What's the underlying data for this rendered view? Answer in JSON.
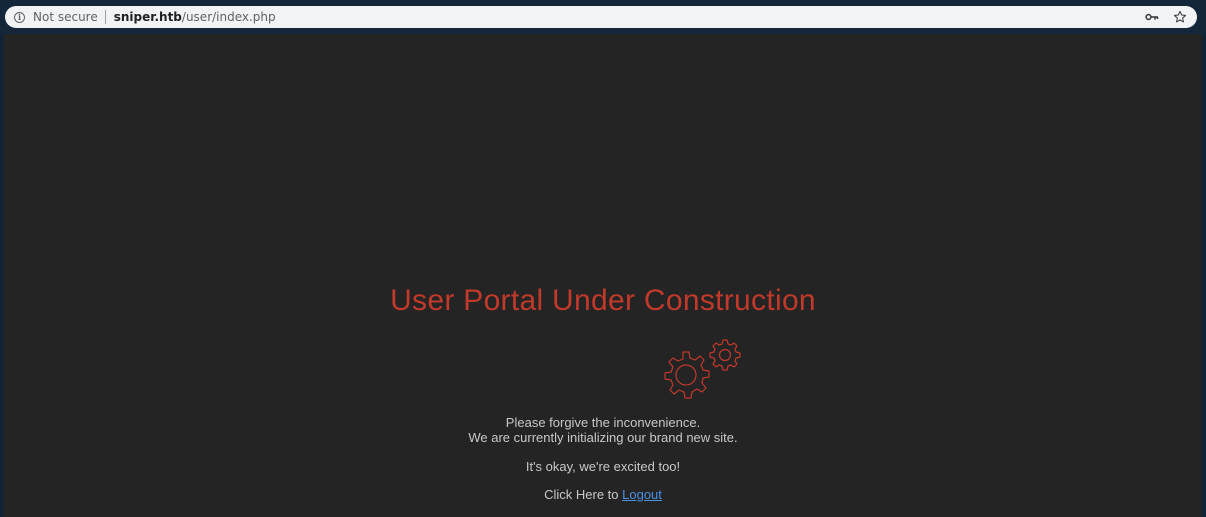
{
  "browser": {
    "security_label": "Not secure",
    "url_host": "sniper.htb",
    "url_path": "/user/index.php",
    "icons": [
      "info-icon",
      "key-icon",
      "star-icon"
    ]
  },
  "page": {
    "title": "User Portal Under Construction",
    "line1": "Please forgive the inconvenience.",
    "line2": "We are currently initializing our brand new site.",
    "line3": "It's okay, we're excited too!",
    "logout_prefix": "Click Here to ",
    "logout_label": "Logout",
    "gears_icon": "gears-icon",
    "accent_color": "#c0392b",
    "link_color": "#4a90e2",
    "background_color": "#242424"
  }
}
